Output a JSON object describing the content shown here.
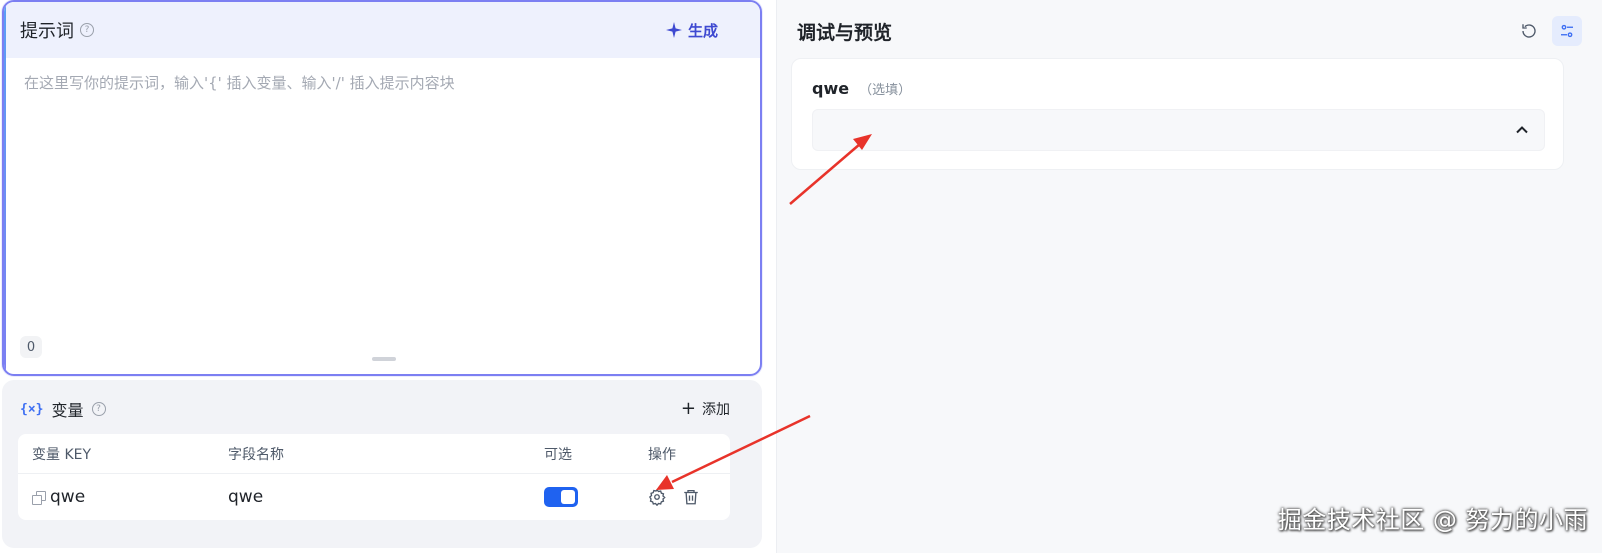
{
  "prompt": {
    "title": "提示词",
    "help_icon": "?",
    "generate_label": "生成",
    "placeholder": "在这里写你的提示词，输入'{' 插入变量、输入'/' 插入提示内容块",
    "char_count": "0"
  },
  "variables": {
    "icon_text": "{×}",
    "title": "变量",
    "help_icon": "?",
    "add_label": "添加",
    "add_symbol": "+",
    "columns": [
      "变量 KEY",
      "字段名称",
      "可选",
      "操作"
    ],
    "rows": [
      {
        "key": "qwe",
        "field_name": "qwe",
        "optional": true
      }
    ]
  },
  "debug": {
    "title": "调试与预览",
    "field": {
      "name": "qwe",
      "optional_hint": "（选填）",
      "value": ""
    }
  },
  "watermark": "掘金技术社区 @ 努力的小雨",
  "colors": {
    "accent": "#3e49d1",
    "toggle_on": "#1f62f0",
    "annotation_arrow": "#e8332a",
    "editor_border": "#7c7ff2"
  },
  "icons": {
    "generate": "sparkle-icon",
    "reset": "refresh-icon",
    "settings_panel": "sliders-icon",
    "row_settings": "gear-icon",
    "row_delete": "trash-icon",
    "select_toggle": "chevron-up-icon",
    "key_copy": "copy-icon"
  }
}
